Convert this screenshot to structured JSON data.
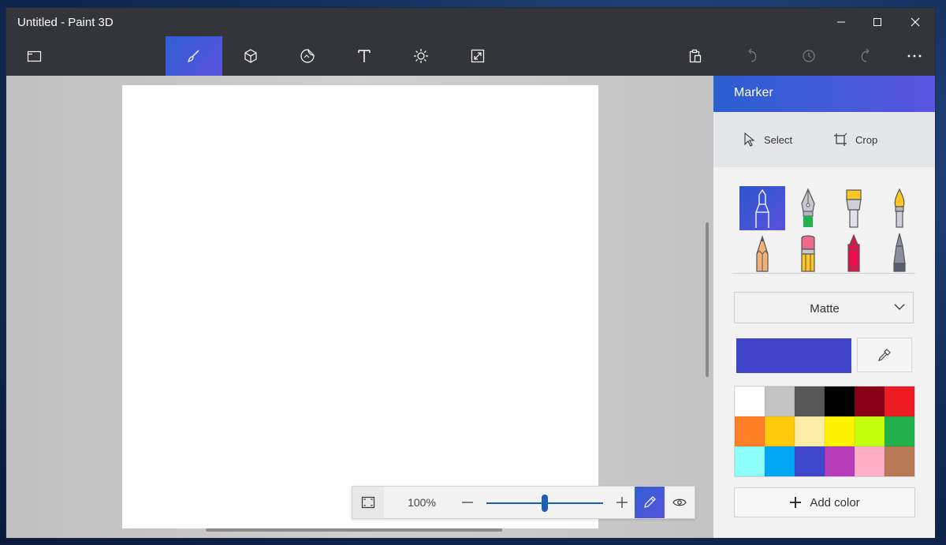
{
  "window": {
    "title": "Untitled - Paint 3D",
    "controls": [
      {
        "name": "minimize",
        "glyph": "—"
      },
      {
        "name": "maximize",
        "glyph": "☐"
      },
      {
        "name": "close",
        "glyph": "✕"
      }
    ]
  },
  "toolbar": {
    "left_icon": "menu-folder-icon",
    "tools": [
      {
        "name": "brushes",
        "icon": "brush-icon",
        "active": true
      },
      {
        "name": "3d-shapes",
        "icon": "cube-icon",
        "active": false
      },
      {
        "name": "stickers",
        "icon": "sticker-icon",
        "active": false
      },
      {
        "name": "text",
        "icon": "text-icon",
        "active": false
      },
      {
        "name": "effects",
        "icon": "sun-icon",
        "active": false
      },
      {
        "name": "canvas",
        "icon": "resize-icon",
        "active": false
      }
    ],
    "right": [
      {
        "name": "paste",
        "icon": "clipboard-icon",
        "enabled": true
      },
      {
        "name": "undo",
        "icon": "undo-icon",
        "enabled": false
      },
      {
        "name": "history",
        "icon": "history-icon",
        "enabled": false
      },
      {
        "name": "redo",
        "icon": "redo-icon",
        "enabled": false
      },
      {
        "name": "more",
        "icon": "ellipsis-icon",
        "enabled": true
      }
    ]
  },
  "zoom": {
    "percent": "100%",
    "level": 0.5
  },
  "panel": {
    "title": "Marker",
    "select_label": "Select",
    "crop_label": "Crop",
    "brushes": [
      {
        "name": "marker",
        "selected": true
      },
      {
        "name": "calligraphy-pen",
        "selected": false
      },
      {
        "name": "oil-brush",
        "selected": false
      },
      {
        "name": "watercolor",
        "selected": false
      },
      {
        "name": "pencil",
        "selected": false
      },
      {
        "name": "eraser",
        "selected": false
      },
      {
        "name": "crayon",
        "selected": false
      },
      {
        "name": "pixel-pen",
        "selected": false
      }
    ],
    "finish": "Matte",
    "current_color": "#3f44c8",
    "palette": [
      "#ffffff",
      "#c3c3c3",
      "#585858",
      "#000000",
      "#880015",
      "#ed1c24",
      "#ff7f27",
      "#ffc90e",
      "#fdeca6",
      "#fff200",
      "#c4ff0e",
      "#22b14c",
      "#8cfffb",
      "#00a8f3",
      "#3f48cc",
      "#b83dba",
      "#ffaec8",
      "#b97a57"
    ],
    "add_color_label": "Add color"
  },
  "colors": {
    "accent_start": "#2a5fcf",
    "accent_end": "#5a55e2",
    "titlebar": "#33353b"
  }
}
